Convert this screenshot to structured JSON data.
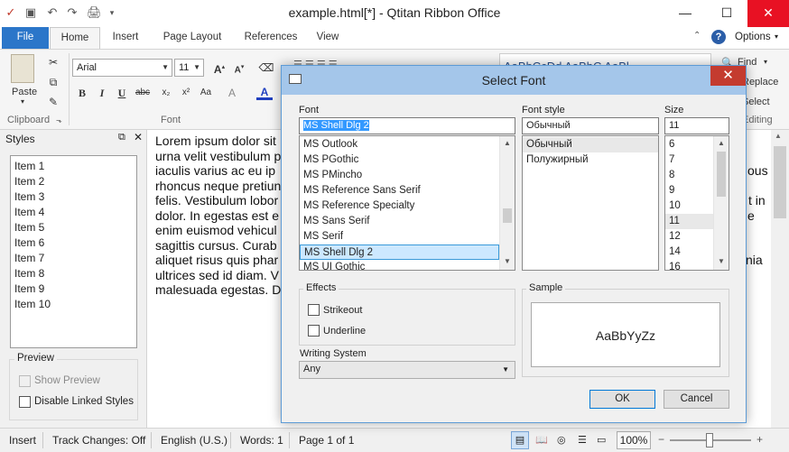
{
  "window": {
    "title": "example.html[*] - Qtitan Ribbon Office",
    "minimize": "—",
    "maximize": "☐",
    "close": "✕"
  },
  "quick_access": [
    "↶",
    "↷",
    "🖨",
    "▾"
  ],
  "tabs": [
    "File",
    "Home",
    "Insert",
    "Page Layout",
    "References",
    "View"
  ],
  "options_label": "Options",
  "ribbon": {
    "clipboard_label": "Clipboard",
    "paste_label": "Paste",
    "font_label": "Font",
    "font_name": "Arial",
    "font_size": "11",
    "editing_label": "Editing",
    "find_label": "Find",
    "replace_label": "Replace",
    "select_label": "Select",
    "styles_preview": "AaBbCcDd AaBbC AaBl"
  },
  "styles_pane": {
    "title": "Styles",
    "items": [
      "Item 1",
      "Item 2",
      "Item 3",
      "Item 4",
      "Item 5",
      "Item 6",
      "Item 7",
      "Item 8",
      "Item 9",
      "Item 10"
    ],
    "preview_label": "Preview",
    "show_preview": "Show Preview",
    "disable_linked": "Disable Linked Styles"
  },
  "document": {
    "lines_left": [
      "Lorem ipsum dolor sit",
      "urna velit vestibulum p",
      "iaculis varius ac eu ip",
      "rhoncus neque pretiun",
      "felis. Vestibulum lobor",
      "dolor. In egestas est e",
      "enim euismod vehicul",
      "sagittis cursus. Curab",
      "aliquet risus quis phar",
      "ultrices sed id diam. V",
      "malesuada egestas. Do"
    ],
    "lines_right": [
      {
        "row": 2,
        "text": "ous"
      },
      {
        "row": 4,
        "text": "t in"
      },
      {
        "row": 5,
        "text": "e"
      },
      {
        "row": 8,
        "text": "nia"
      }
    ]
  },
  "dialog": {
    "title": "Select Font",
    "font_label": "Font",
    "font_value": "MS Shell Dlg 2",
    "fonts": [
      "MS Outlook",
      "MS PGothic",
      "MS PMincho",
      "MS Reference Sans Serif",
      "MS Reference Specialty",
      "MS Sans Serif",
      "MS Serif",
      "MS Shell Dlg 2",
      "MS UI Gothic"
    ],
    "selected_font_index": 7,
    "style_label": "Font style",
    "style_value": "Обычный",
    "styles": [
      "Обычный",
      "Полужирный"
    ],
    "size_label": "Size",
    "size_value": "11",
    "sizes": [
      "6",
      "7",
      "8",
      "9",
      "10",
      "11",
      "12",
      "14",
      "16"
    ],
    "selected_size_index": 5,
    "effects_label": "Effects",
    "strikeout_label": "Strikeout",
    "underline_label": "Underline",
    "writing_system_label": "Writing System",
    "writing_system_value": "Any",
    "sample_label": "Sample",
    "sample_text": "AaBbYyZz",
    "ok_label": "OK",
    "cancel_label": "Cancel"
  },
  "statusbar": {
    "mode": "Insert",
    "track_changes": "Track Changes: Off",
    "language": "English (U.S.)",
    "words": "Words: 1",
    "page": "Page 1 of 1",
    "zoom": "100%"
  },
  "colors": {
    "file_tab": "#2b76c9",
    "dialog_title": "#a4c6ea",
    "selection": "#cce8ff",
    "close_red": "#e81123"
  }
}
